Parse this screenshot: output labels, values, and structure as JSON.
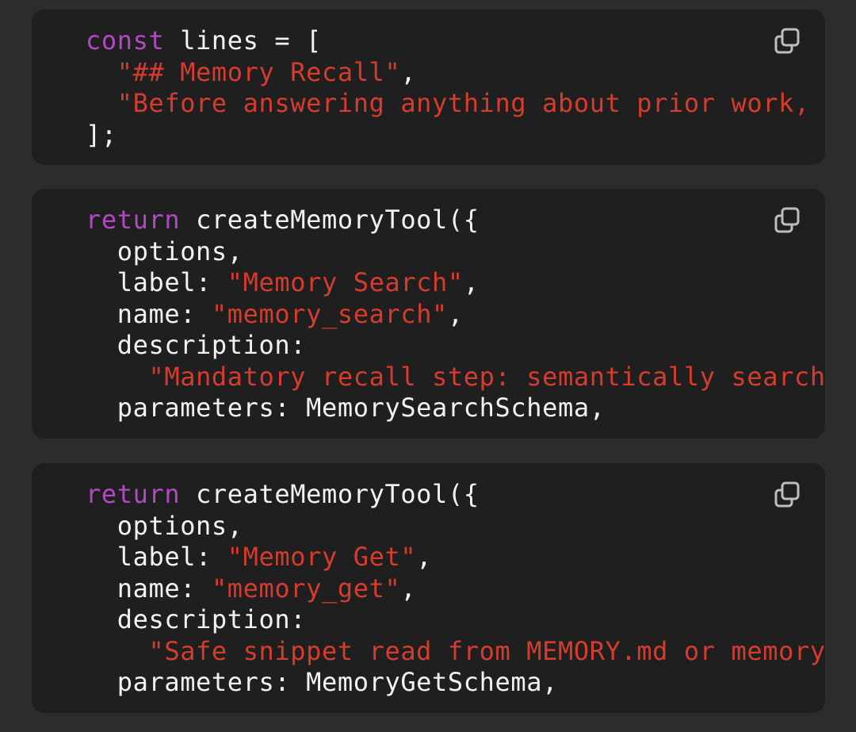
{
  "colors": {
    "background": "#2c2c2c",
    "code_background": "#1f1f1f",
    "keyword": "#b348c4",
    "string": "#d63c2e",
    "text": "#f2f2f2",
    "icon": "#bdbdbd"
  },
  "blocks": [
    {
      "copy_icon": "copy-icon",
      "lines": [
        {
          "indent": "",
          "k": "const",
          "t1": " lines = [",
          "s": "",
          "t2": ""
        },
        {
          "indent": "  ",
          "k": "",
          "t1": "",
          "s": "\"## Memory Recall\"",
          "t2": ","
        },
        {
          "indent": "  ",
          "k": "",
          "t1": "",
          "s": "\"Before answering anything about prior work, de",
          "t2": ""
        },
        {
          "indent": "",
          "k": "",
          "t1": "];",
          "s": "",
          "t2": ""
        }
      ]
    },
    {
      "copy_icon": "copy-icon",
      "lines": [
        {
          "indent": "",
          "k": "return",
          "t1": " createMemoryTool({",
          "s": "",
          "t2": ""
        },
        {
          "indent": "  ",
          "k": "",
          "t1": "options,",
          "s": "",
          "t2": ""
        },
        {
          "indent": "  ",
          "k": "",
          "t1": "label: ",
          "s": "\"Memory Search\"",
          "t2": ","
        },
        {
          "indent": "  ",
          "k": "",
          "t1": "name: ",
          "s": "\"memory_search\"",
          "t2": ","
        },
        {
          "indent": "  ",
          "k": "",
          "t1": "description:",
          "s": "",
          "t2": ""
        },
        {
          "indent": "    ",
          "k": "",
          "t1": "",
          "s": "\"Mandatory recall step: semantically search M",
          "t2": ""
        },
        {
          "indent": "  ",
          "k": "",
          "t1": "parameters: MemorySearchSchema,",
          "s": "",
          "t2": ""
        }
      ]
    },
    {
      "copy_icon": "copy-icon",
      "lines": [
        {
          "indent": "",
          "k": "return",
          "t1": " createMemoryTool({",
          "s": "",
          "t2": ""
        },
        {
          "indent": "  ",
          "k": "",
          "t1": "options,",
          "s": "",
          "t2": ""
        },
        {
          "indent": "  ",
          "k": "",
          "t1": "label: ",
          "s": "\"Memory Get\"",
          "t2": ","
        },
        {
          "indent": "  ",
          "k": "",
          "t1": "name: ",
          "s": "\"memory_get\"",
          "t2": ","
        },
        {
          "indent": "  ",
          "k": "",
          "t1": "description:",
          "s": "",
          "t2": ""
        },
        {
          "indent": "    ",
          "k": "",
          "t1": "",
          "s": "\"Safe snippet read from MEMORY.md or memory/*",
          "t2": ""
        },
        {
          "indent": "  ",
          "k": "",
          "t1": "parameters: MemoryGetSchema,",
          "s": "",
          "t2": ""
        }
      ]
    }
  ]
}
